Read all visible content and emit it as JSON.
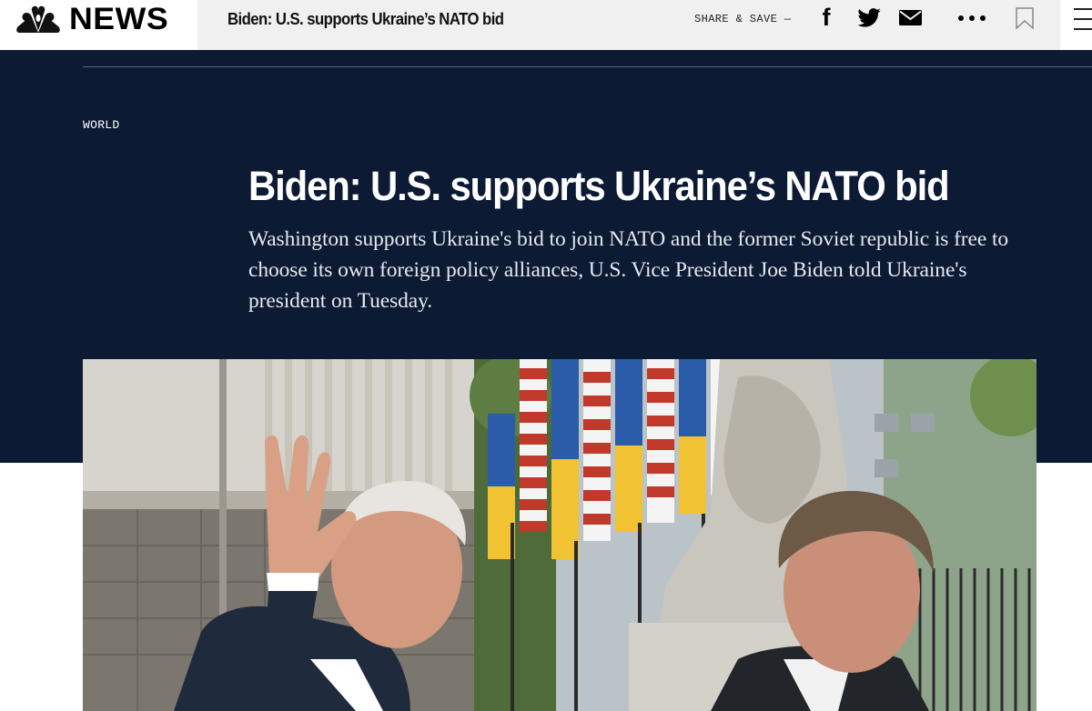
{
  "header": {
    "brand_name": "NEWS",
    "article_short_title": "Biden: U.S. supports Ukraine’s NATO bid",
    "share_label": "SHARE & SAVE —",
    "facebook_glyph": "f",
    "icons": [
      "nbc-peacock-logo",
      "facebook-icon",
      "twitter-icon",
      "email-icon",
      "more-icon",
      "bookmark-icon",
      "hamburger-menu-icon"
    ]
  },
  "article": {
    "section": "WORLD",
    "headline": "Biden: U.S. supports Ukraine’s NATO bid",
    "dek": "Washington supports Ukraine's bid to join NATO and the former Soviet republic is free to choose its own foreign policy alliances, U.S. Vice President Joe Biden told Ukraine's president on Tuesday."
  },
  "colors": {
    "hero_background": "#0c1a33",
    "topbar_background": "#f0f0f0",
    "text_on_dark": "#ffffff"
  }
}
